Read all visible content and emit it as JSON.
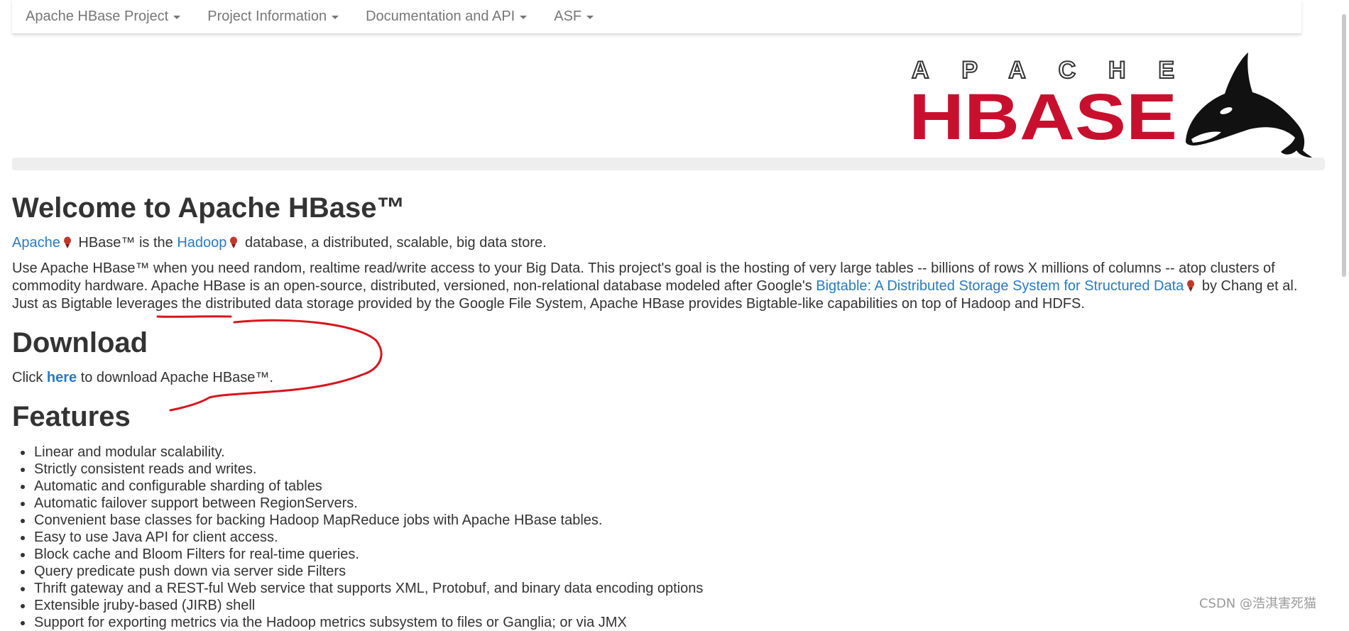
{
  "navbar": {
    "items": [
      {
        "label": "Apache HBase Project"
      },
      {
        "label": "Project Information"
      },
      {
        "label": "Documentation and API"
      },
      {
        "label": "ASF"
      }
    ]
  },
  "logo": {
    "top_text": "APACHE",
    "main_text": "HBASE"
  },
  "main": {
    "title": "Welcome to Apache HBase™",
    "intro": {
      "link_apache": "Apache",
      "text_1": " HBase™ is the ",
      "link_hadoop": "Hadoop",
      "text_2": " database, a distributed, scalable, big data store."
    },
    "description": {
      "text_1": "Use Apache HBase™ when you need random, realtime read/write access to your Big Data. This project's goal is the hosting of very large tables -- billions of rows X millions of columns -- atop clusters of commodity hardware. Apache HBase is an open-source, distributed, versioned, non-relational database modeled after Google's ",
      "link_bigtable": "Bigtable: A Distributed Storage System for Structured Data",
      "text_2": " by Chang et al. Just as Bigtable leverages the distributed data storage provided by the Google File System, Apache HBase provides Bigtable-like capabilities on top of Hadoop and HDFS."
    },
    "download": {
      "title": "Download",
      "text_1": "Click ",
      "link_here": "here",
      "text_2": " to download Apache HBase™."
    },
    "features": {
      "title": "Features",
      "items": [
        "Linear and modular scalability.",
        "Strictly consistent reads and writes.",
        "Automatic and configurable sharding of tables",
        "Automatic failover support between RegionServers.",
        "Convenient base classes for backing Hadoop MapReduce jobs with Apache HBase tables.",
        "Easy to use Java API for client access.",
        "Block cache and Bloom Filters for real-time queries.",
        "Query predicate push down via server side Filters",
        "Thrift gateway and a REST-ful Web service that supports XML, Protobuf, and binary data encoding options",
        "Extensible jruby-based (JIRB) shell",
        "Support for exporting metrics via the Hadoop metrics subsystem to files or Ganglia; or via JMX"
      ]
    }
  },
  "watermark": "CSDN @浩淇害死猫",
  "colors": {
    "link": "#2a7ac0",
    "logo_red": "#c8102e",
    "annotation": "#d8141e"
  }
}
